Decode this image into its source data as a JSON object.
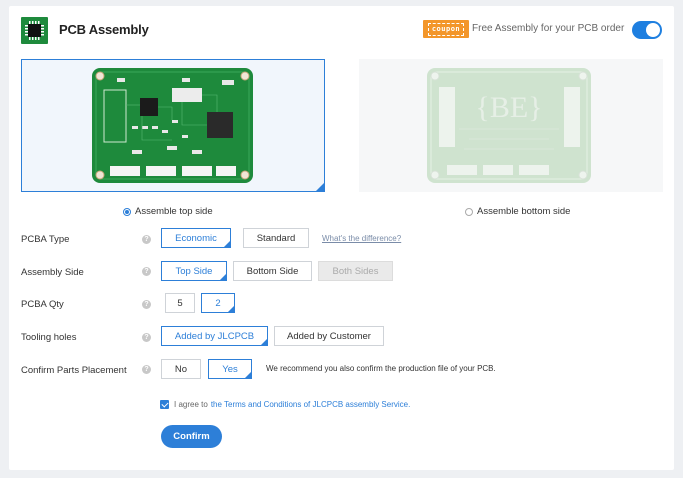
{
  "header": {
    "title": "PCB Assembly",
    "coupon_label": "coupon",
    "promo_text": "Free Assembly for your PCB order",
    "toggle_on": true,
    "icon": "chip-icon"
  },
  "preview": {
    "top_label": "Assemble top side",
    "bottom_label": "Assemble bottom side",
    "selected": "top"
  },
  "form": {
    "pcba_type": {
      "label": "PCBA Type",
      "options": [
        "Economic",
        "Standard"
      ],
      "selected": "Economic",
      "help_link": "What's the difference?"
    },
    "assembly_side": {
      "label": "Assembly Side",
      "options": [
        "Top Side",
        "Bottom Side",
        "Both Sides"
      ],
      "selected": "Top Side",
      "disabled": "Both Sides"
    },
    "pcba_qty": {
      "label": "PCBA Qty",
      "options": [
        "5",
        "2"
      ],
      "selected": "2"
    },
    "tooling_holes": {
      "label": "Tooling holes",
      "options": [
        "Added by JLCPCB",
        "Added by Customer"
      ],
      "selected": "Added by JLCPCB"
    },
    "confirm_parts": {
      "label": "Confirm Parts Placement",
      "options": [
        "No",
        "Yes"
      ],
      "selected": "Yes",
      "note": "We recommend you also confirm the production file of your PCB."
    },
    "help_glyph": "?"
  },
  "agreement": {
    "checked": true,
    "prefix": "I agree to",
    "link": "the Terms and Conditions of JLCPCB assembly Service."
  },
  "confirm_label": "Confirm",
  "colors": {
    "accent": "#2d7fd8",
    "coupon": "#f3962a",
    "pcb_green": "#1e8a3c"
  }
}
